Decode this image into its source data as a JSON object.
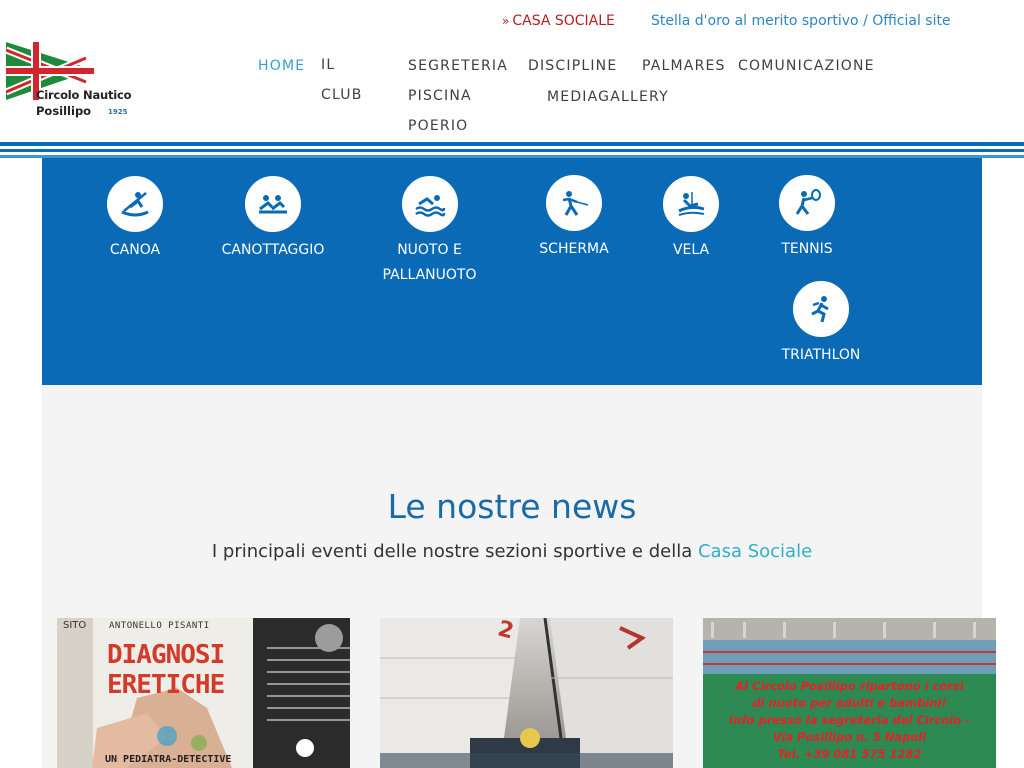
{
  "brand": {
    "name_line1": "Circolo Nautico",
    "name_line2": "Posillipo",
    "year": "1925"
  },
  "top_links": {
    "casa_sociale": "CASA SOCIALE",
    "stella": "Stella d'oro al merito sportivo / Official site"
  },
  "nav": {
    "home": "HOME",
    "il": "IL",
    "club": "CLUB",
    "segreteria": "SEGRETERIA",
    "piscina": "PISCINA",
    "poerio": "POERIO",
    "discipline": "DISCIPLINE",
    "palmares": "PALMARES",
    "comunicazione": "COMUNICAZIONE",
    "mediagallery": "MEDIAGALLERY"
  },
  "disciplines": [
    {
      "label": "CANOA",
      "icon": "canoe-icon"
    },
    {
      "label": "CANOTTAGGIO",
      "icon": "rowing-icon"
    },
    {
      "label": "NUOTO E\nPALLANUOTO",
      "icon": "swimming-icon"
    },
    {
      "label": "SCHERMA",
      "icon": "fencing-icon"
    },
    {
      "label": "VELA",
      "icon": "sailing-icon"
    },
    {
      "label": "TENNIS",
      "icon": "tennis-icon"
    },
    {
      "label": "TRIATHLON",
      "icon": "running-icon"
    }
  ],
  "news": {
    "title": "Le nostre news",
    "subtitle": "I principali eventi delle nostre sezioni sportive e della ",
    "subtitle_link": "Casa Sociale"
  },
  "cards": [
    {
      "author": "ANTONELLO PISANTI",
      "title_line1": "DIAGNOSI",
      "title_line2": "ERETICHE",
      "bottom": "UN PEDIATRA-DETECTIVE",
      "left_strip": "SITO"
    },
    {
      "sail_mark": "2"
    },
    {
      "lines": [
        "Al Circolo Posillipo ripartono i corsi",
        "di nuoto per adulti e bambini!",
        "Info presso la segreteria del Circolo -",
        "Via Posillipo n. 5 Napoli",
        "Tel. +39 081 575 1282"
      ]
    }
  ],
  "colors": {
    "brand_blue": "#0a6ab6",
    "accent_red": "#b51f1f",
    "link_blue": "#2d86c4",
    "active_nav": "#36a0cc"
  }
}
